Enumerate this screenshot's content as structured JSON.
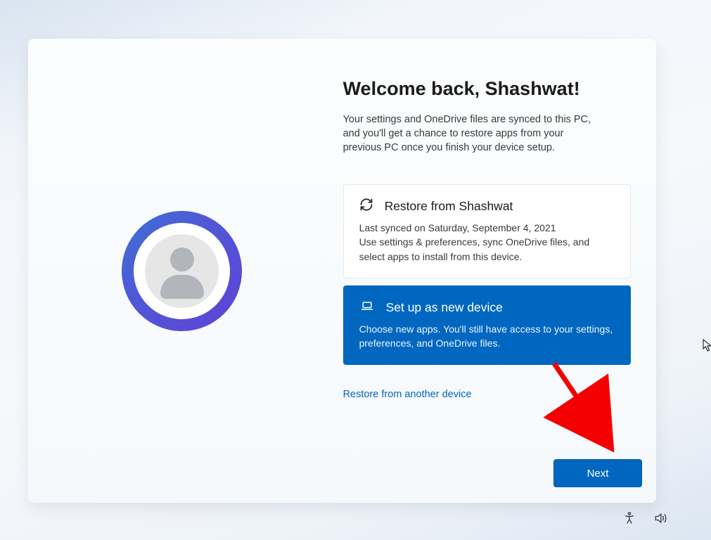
{
  "title": "Welcome back, Shashwat!",
  "subtitle": "Your settings and OneDrive files are synced to this PC, and you'll get a chance to restore apps from your previous PC once you finish your device setup.",
  "options": {
    "restore": {
      "title": "Restore from Shashwat",
      "desc": "Last synced on Saturday, September 4, 2021\nUse settings & preferences, sync OneDrive files, and select apps to install from this device."
    },
    "new_device": {
      "title": "Set up as new device",
      "desc": "Choose new apps. You'll still have access to your settings, preferences, and OneDrive files."
    }
  },
  "link_text": "Restore from another device",
  "next_label": "Next"
}
